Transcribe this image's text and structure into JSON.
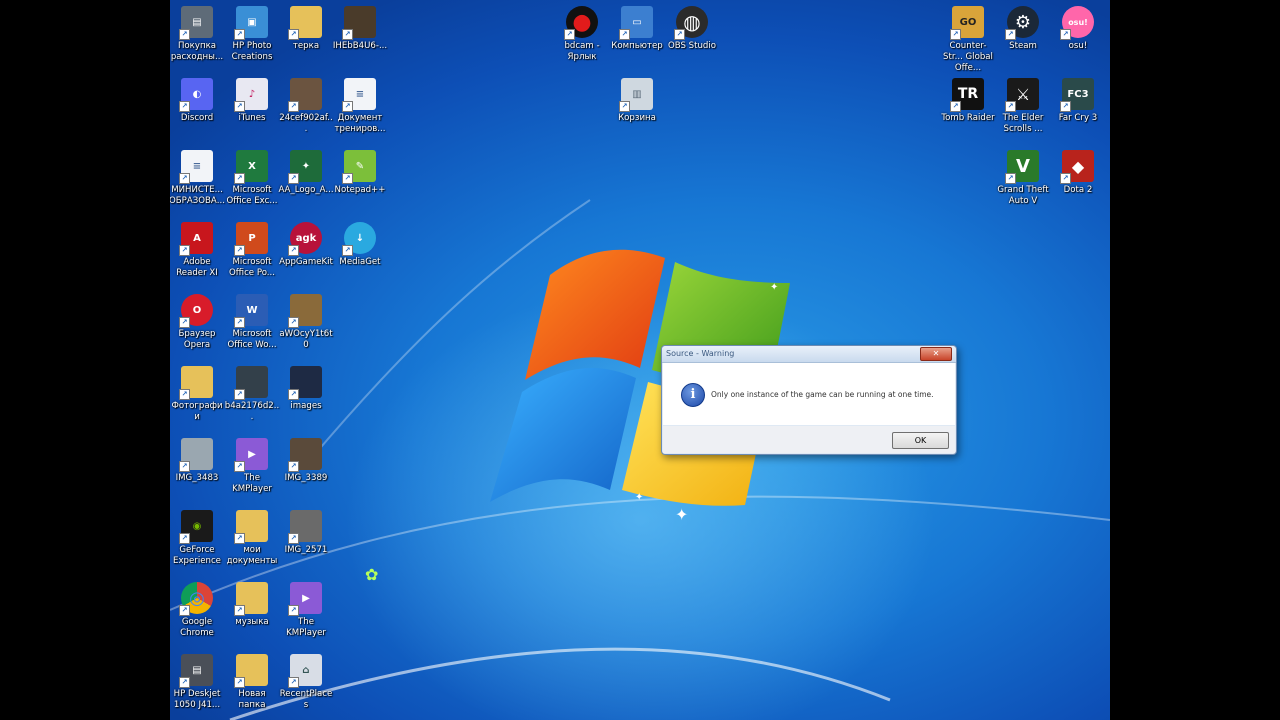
{
  "desktop": {
    "icons": [
      {
        "id": "printer",
        "label": "Покупка расходны...",
        "icon": "printer-icon",
        "color": "#5e6b78",
        "glyph": "▤"
      },
      {
        "id": "hp-photo",
        "label": "HP Photo Creations",
        "icon": "photo-icon",
        "color": "#3a8fd6",
        "glyph": "▣"
      },
      {
        "id": "terka",
        "label": "терка",
        "icon": "folder-icon",
        "color": "#e6c15a",
        "glyph": ""
      },
      {
        "id": "iheb",
        "label": "IHEbB4U6-...",
        "icon": "image-icon",
        "color": "#4a3b2a",
        "glyph": ""
      },
      {
        "id": "discord",
        "label": "Discord",
        "icon": "discord-icon",
        "color": "#5865f2",
        "glyph": "◐"
      },
      {
        "id": "itunes",
        "label": "iTunes",
        "icon": "itunes-icon",
        "color": "#e8e8f2",
        "glyph": "♪"
      },
      {
        "id": "img24",
        "label": "24cef902af...",
        "icon": "image-icon",
        "color": "#6b5440",
        "glyph": ""
      },
      {
        "id": "doc-train",
        "label": "Документ трениров...",
        "icon": "document-icon",
        "color": "#f2f4f8",
        "glyph": "≡"
      },
      {
        "id": "ministry",
        "label": "МИНИСТЕ... ОБРАЗОВА...",
        "icon": "document-icon",
        "color": "#f2f4f8",
        "glyph": "≡"
      },
      {
        "id": "excel",
        "label": "Microsoft Office Exc...",
        "icon": "excel-icon",
        "color": "#1f7a3e",
        "glyph": "X"
      },
      {
        "id": "aa-logo",
        "label": "AA_Logo_A...",
        "icon": "image-icon",
        "color": "#1e6b3a",
        "glyph": "✦"
      },
      {
        "id": "notepadpp",
        "label": "Notepad++",
        "icon": "notepad-plus-icon",
        "color": "#7cbf3a",
        "glyph": "✎"
      },
      {
        "id": "adobe",
        "label": "Adobe Reader XI",
        "icon": "adobe-reader-icon",
        "color": "#c8161d",
        "glyph": "A"
      },
      {
        "id": "powerpoint",
        "label": "Microsoft Office Po...",
        "icon": "powerpoint-icon",
        "color": "#d04a1c",
        "glyph": "P"
      },
      {
        "id": "appgamekit",
        "label": "AppGameKit",
        "icon": "appgamekit-icon",
        "color": "#b8123a",
        "glyph": "agk"
      },
      {
        "id": "mediaget",
        "label": "MediaGet",
        "icon": "mediaget-icon",
        "color": "#2aa9e0",
        "glyph": "↓"
      },
      {
        "id": "opera",
        "label": "Браузер Opera",
        "icon": "opera-icon",
        "color": "#d81c2a",
        "glyph": "O"
      },
      {
        "id": "word",
        "label": "Microsoft Office Wo...",
        "icon": "word-icon",
        "color": "#2b5db5",
        "glyph": "W"
      },
      {
        "id": "awocy",
        "label": "aWOcyY1t6t0",
        "icon": "image-icon",
        "color": "#8a6a3a",
        "glyph": ""
      },
      {
        "id": "photos",
        "label": "Фотографии",
        "icon": "folder-icon",
        "color": "#e6c15a",
        "glyph": ""
      },
      {
        "id": "b4a",
        "label": "b4a2176d2...",
        "icon": "image-icon",
        "color": "#33404a",
        "glyph": ""
      },
      {
        "id": "images",
        "label": "images",
        "icon": "image-icon",
        "color": "#1e2a44",
        "glyph": ""
      },
      {
        "id": "img3483",
        "label": "IMG_3483",
        "icon": "image-icon",
        "color": "#9aa7b0",
        "glyph": ""
      },
      {
        "id": "kmplayer1",
        "label": "The KMPlayer",
        "icon": "kmplayer-icon",
        "color": "#8b5ad6",
        "glyph": "▶"
      },
      {
        "id": "img3389",
        "label": "IMG_3389",
        "icon": "image-icon",
        "color": "#5a4a3a",
        "glyph": ""
      },
      {
        "id": "geforce",
        "label": "GeForce Experience",
        "icon": "geforce-icon",
        "color": "#76b900",
        "glyph": "◉"
      },
      {
        "id": "mydocs",
        "label": "мои документы",
        "icon": "folder-icon",
        "color": "#e6c15a",
        "glyph": ""
      },
      {
        "id": "img2571",
        "label": "IMG_2571",
        "icon": "image-icon",
        "color": "#6a6a6a",
        "glyph": ""
      },
      {
        "id": "chrome",
        "label": "Google Chrome",
        "icon": "chrome-icon",
        "color": "#ffffff",
        "glyph": "◎"
      },
      {
        "id": "music",
        "label": "музыка",
        "icon": "folder-icon",
        "color": "#e6c15a",
        "glyph": ""
      },
      {
        "id": "kmplayer2",
        "label": "The KMPlayer",
        "icon": "kmplayer-icon",
        "color": "#8b5ad6",
        "glyph": "▶"
      },
      {
        "id": "hp-deskjet",
        "label": "HP Deskjet 1050 J41...",
        "icon": "printer-icon",
        "color": "#4a4f58",
        "glyph": "▤"
      },
      {
        "id": "newfolder",
        "label": "Новая папка",
        "icon": "folder-icon",
        "color": "#e6c15a",
        "glyph": ""
      },
      {
        "id": "recent",
        "label": "RecentPlaces",
        "icon": "recent-places-icon",
        "color": "#d8dde6",
        "glyph": "⌂"
      },
      {
        "id": "bdcam",
        "label": "bdcam - Ярлык",
        "icon": "bdcam-icon",
        "color": "#111111",
        "glyph": "●"
      },
      {
        "id": "computer",
        "label": "Компьютер",
        "icon": "computer-icon",
        "color": "#3c7fd0",
        "glyph": "▭"
      },
      {
        "id": "obs",
        "label": "OBS Studio",
        "icon": "obs-icon",
        "color": "#2b2b2b",
        "glyph": "◍"
      },
      {
        "id": "recycle",
        "label": "Корзина",
        "icon": "recycle-bin-icon",
        "color": "#cfd8e0",
        "glyph": "▥"
      },
      {
        "id": "csgo",
        "label": "Counter-Str... Global Offe...",
        "icon": "csgo-icon",
        "color": "#d9a43a",
        "glyph": "GO"
      },
      {
        "id": "steam",
        "label": "Steam",
        "icon": "steam-icon",
        "color": "#1b2838",
        "glyph": "⚙"
      },
      {
        "id": "osu",
        "label": "osu!",
        "icon": "osu-icon",
        "color": "#ff66aa",
        "glyph": "osu!"
      },
      {
        "id": "tombraider",
        "label": "Tomb Raider",
        "icon": "tomb-raider-icon",
        "color": "#111111",
        "glyph": "TR"
      },
      {
        "id": "skyrim",
        "label": "The Elder Scrolls ...",
        "icon": "elder-scrolls-icon",
        "color": "#1a1a1a",
        "glyph": "⚔"
      },
      {
        "id": "farcry3",
        "label": "Far Cry 3",
        "icon": "far-cry-icon",
        "color": "#2a4a4a",
        "glyph": "FC3"
      },
      {
        "id": "gta5",
        "label": "Grand Theft Auto V",
        "icon": "gta-icon",
        "color": "#2a7a2a",
        "glyph": "V"
      },
      {
        "id": "dota2",
        "label": "Dota 2",
        "icon": "dota-icon",
        "color": "#b8231c",
        "glyph": "◆"
      }
    ]
  },
  "dialog": {
    "title": "Source - Warning",
    "close_glyph": "✕",
    "info_glyph": "i",
    "message": "Only one instance of the game can be running at one time.",
    "ok_label": "OK"
  }
}
